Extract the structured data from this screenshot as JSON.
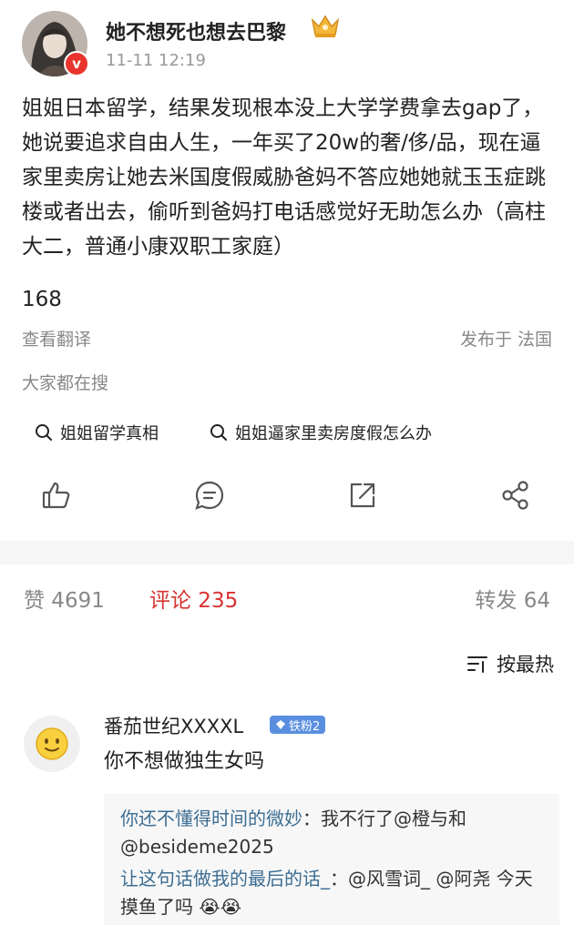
{
  "post": {
    "username": "她不想死也想去巴黎",
    "timestamp": "11-11 12:19",
    "body": "姐姐日本留学，结果发现根本没上大学学费拿去gap了，她说要追求自由人生，一年买了20w的奢/侈/品，现在逼家里卖房让她去米国度假威胁爸妈不答应她她就玉玉症跳楼或者出去，偷听到爸妈打电话感觉好无助怎么办（高柱大二，普通小康双职工家庭）",
    "views": "168",
    "translate_label": "查看翻译",
    "location": "发布于 法国"
  },
  "search": {
    "title": "大家都在搜",
    "chips": [
      "姐姐留学真相",
      "姐姐逼家里卖房度假怎么办"
    ]
  },
  "actions": {
    "icons": [
      "like-icon",
      "comment-icon",
      "repost-icon",
      "share-icon"
    ]
  },
  "stats": {
    "likes": "赞 4691",
    "comments": "评论 235",
    "reposts": "转发 64"
  },
  "sort": {
    "label": "按最热"
  },
  "comment": {
    "name": "番茄世纪XXXXL",
    "badge": "铁粉2",
    "text": "你不想做独生女吗",
    "replies": [
      {
        "nick": "你还不懂得时间的微妙",
        "sep": "：",
        "text": "我不行了@橙与和 @besideme2025"
      },
      {
        "nick": "让这句话做我的最后的话_",
        "sep": "：",
        "text": "@风雪词_ @阿尧 今天摸鱼了吗 😭😭"
      }
    ]
  },
  "colors": {
    "accent": "#d83232",
    "muted": "#888888",
    "badge": "#5a8fe0",
    "verified": "#e8342d",
    "nick": "#3c6e93"
  }
}
